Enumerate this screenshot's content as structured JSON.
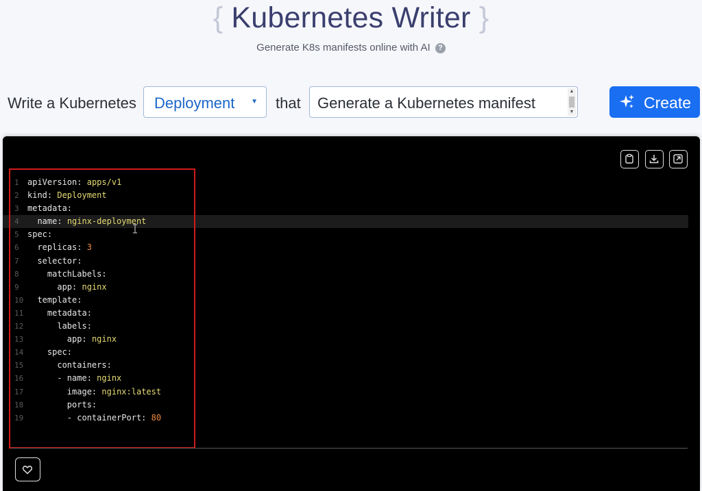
{
  "header": {
    "brace_open": "{",
    "title": "Kubernetes Writer",
    "brace_close": "}",
    "subtitle": "Generate K8s manifests online with AI",
    "help_icon": "?"
  },
  "prompt": {
    "prefix": "Write a Kubernetes",
    "resource_type": "Deployment",
    "connector": "that",
    "input_value": "Generate a Kubernetes manifest",
    "create_label": "Create"
  },
  "toolbar": {
    "icons": [
      "clipboard-icon",
      "download-icon",
      "open-external-icon"
    ]
  },
  "code": {
    "lines": [
      {
        "n": "1",
        "text": "apiVersion: apps/v1"
      },
      {
        "n": "2",
        "text": "kind: Deployment"
      },
      {
        "n": "3",
        "text": "metadata:"
      },
      {
        "n": "4",
        "text": "  name: nginx-deployment"
      },
      {
        "n": "5",
        "text": "spec:"
      },
      {
        "n": "6",
        "text": "  replicas: 3"
      },
      {
        "n": "7",
        "text": "  selector:"
      },
      {
        "n": "8",
        "text": "    matchLabels:"
      },
      {
        "n": "9",
        "text": "      app: nginx"
      },
      {
        "n": "10",
        "text": "  template:"
      },
      {
        "n": "11",
        "text": "    metadata:"
      },
      {
        "n": "12",
        "text": "      labels:"
      },
      {
        "n": "13",
        "text": "        app: nginx"
      },
      {
        "n": "14",
        "text": "    spec:"
      },
      {
        "n": "15",
        "text": "      containers:"
      },
      {
        "n": "16",
        "text": "      - name: nginx"
      },
      {
        "n": "17",
        "text": "        image: nginx:latest"
      },
      {
        "n": "18",
        "text": "        ports:"
      },
      {
        "n": "19",
        "text": "        - containerPort: 80"
      }
    ],
    "active_line": 4
  },
  "colors": {
    "key": "#e8e8e8",
    "string": "#e6db74",
    "number": "#f0883e",
    "accent": "#1a6ef2",
    "highlight": "#d21b1b"
  },
  "footer": {
    "favorite_icon": "heart-icon"
  }
}
